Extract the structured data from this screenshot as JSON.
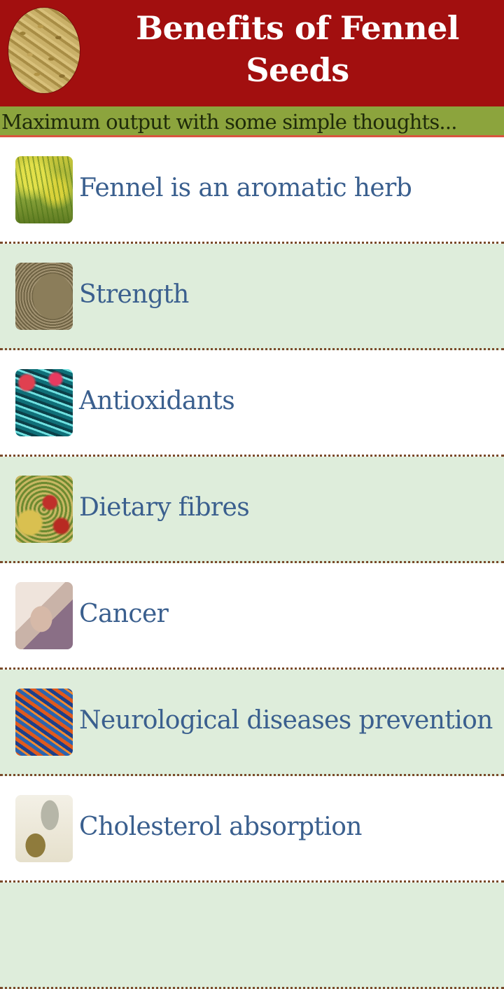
{
  "header": {
    "title": "Benefits of Fennel Seeds",
    "logo_icon": "fennel-seeds-image",
    "background_color": "#a20f0f"
  },
  "tagline": {
    "text": "Maximum output with some simple thoughts...",
    "background_color": "#8ca43d"
  },
  "list": {
    "items": [
      {
        "label": "Fennel is an aromatic herb",
        "icon": "fennel-plant-thumbnail"
      },
      {
        "label": "Strength",
        "icon": "fennel-seeds-bowl-thumbnail"
      },
      {
        "label": "Antioxidants",
        "icon": "cells-thumbnail"
      },
      {
        "label": "Dietary fibres",
        "icon": "fibre-food-thumbnail"
      },
      {
        "label": "Cancer",
        "icon": "patient-thumbnail"
      },
      {
        "label": "Neurological diseases prevention",
        "icon": "neurons-thumbnail"
      },
      {
        "label": "Cholesterol absorption",
        "icon": "seeds-jar-thumbnail"
      }
    ],
    "label_color": "#3a5f8e",
    "alt_row_color": "#deeddb"
  }
}
